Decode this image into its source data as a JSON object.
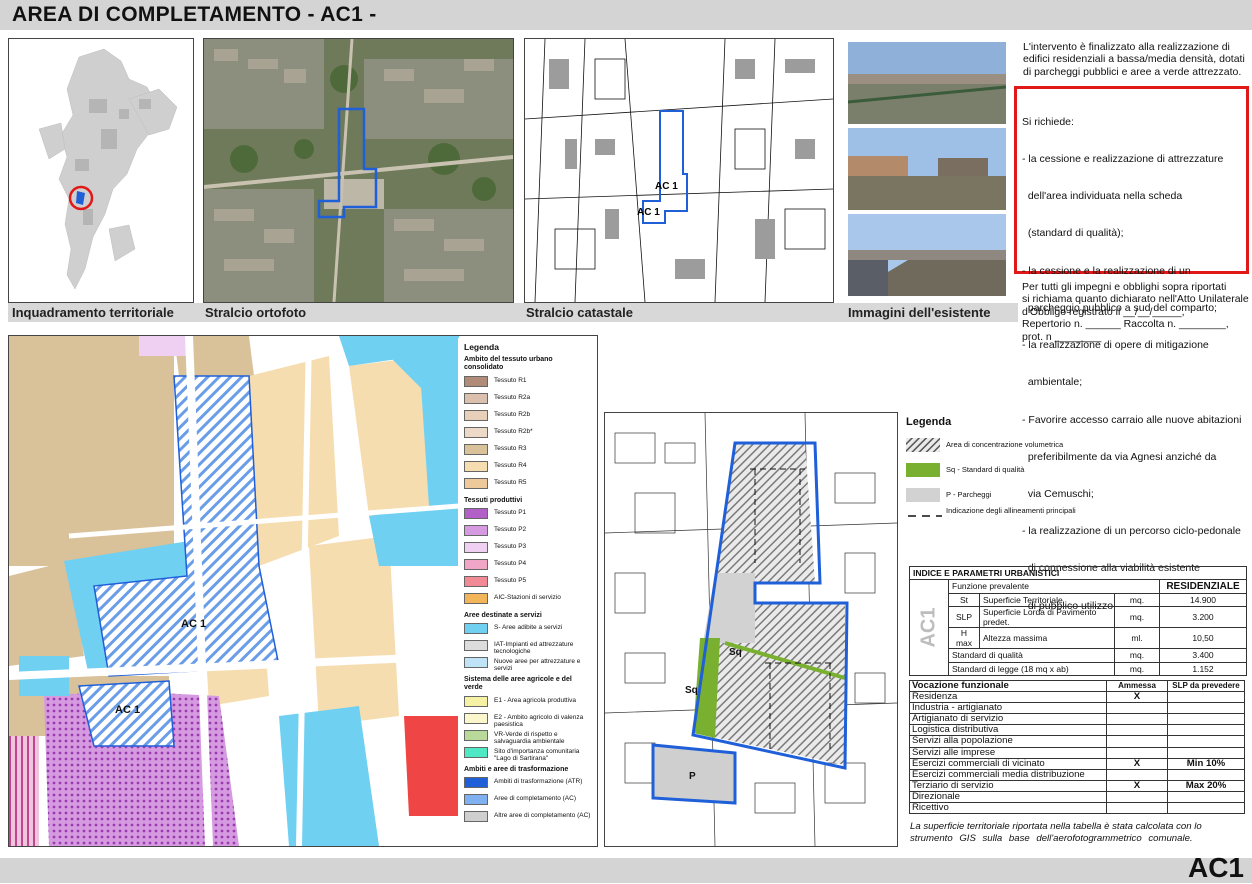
{
  "title": "AREA DI COMPLETAMENTO - AC1 -",
  "code": "AC1",
  "captions": {
    "territorial": "Inquadramento territoriale",
    "ortofoto": "Stralcio ortofoto",
    "catastale": "Stralcio catastale",
    "immagini": "Immagini dell'esistente"
  },
  "intro": [
    "L'intervento è finalizzato alla realizzazione di",
    "edifici residenziali a bassa/media densità, dotati",
    "di parcheggi pubblici e aree a verde attrezzato."
  ],
  "requirements": {
    "heading": "Si richiede:",
    "lines": [
      "- la cessione e realizzazione di attrezzature",
      "  dell'area individuata nella scheda",
      "  (standard di qualità);",
      "- la cessione e la realizzazione di un",
      "  parcheggio pubblico a sud del comparto;",
      "- la realizzazione di opere di mitigazione",
      "  ambientale;",
      "- Favorire accesso carraio alle nuove abitazioni",
      "  preferibilmente da via Agnesi anziché da",
      "  via Cemuschi;",
      "- la realizzazione di un percorso ciclo-pedonale",
      "  di connessione alla viabilità esistente",
      "  di pubblico utilizzo."
    ]
  },
  "obligations": [
    "Per tutti gli impegni e obblighi sopra riportati",
    "si richiama quanto dichiarato nell'Atto Unilaterale",
    "d'Obbligo registrato il __/__/_____,",
    "Repertorio n. ______ Raccolta n. ________,",
    "prot. n ________"
  ],
  "plan_map": {
    "labels": [
      "AC 1",
      "AC 1"
    ],
    "legend": {
      "title": "Legenda",
      "sections": [
        {
          "heading": "Ambito del tessuto urbano consolidato",
          "items": [
            {
              "label": "Tessuto R1",
              "color": "#b08c78"
            },
            {
              "label": "Tessuto R2a",
              "color": "#dcc0ae"
            },
            {
              "label": "Tessuto R2b",
              "color": "#e8cfb9"
            },
            {
              "label": "Tessuto R2b*",
              "color": "#ecd9c8"
            },
            {
              "label": "Tessuto R3",
              "color": "#d9c19a"
            },
            {
              "label": "Tessuto R4",
              "color": "#f6ddb0"
            },
            {
              "label": "Tessuto R5",
              "color": "#edc99c"
            }
          ]
        },
        {
          "heading": "Tessuti produttivi",
          "items": [
            {
              "label": "Tessuto P1",
              "color": "#b35fc8"
            },
            {
              "label": "Tessuto P2",
              "color": "#d59ae0"
            },
            {
              "label": "Tessuto P3",
              "color": "#efd0f2"
            },
            {
              "label": "Tessuto P4",
              "color": "#f0a6c6"
            },
            {
              "label": "Tessuto P5",
              "color": "#f28a96"
            },
            {
              "label": "AIC-Stazioni di servizio",
              "color": "#f2b55a"
            }
          ]
        },
        {
          "heading": "Aree destinate a servizi",
          "items": [
            {
              "label": "S- Aree adibite a servizi",
              "color": "#6fd0f2"
            },
            {
              "label": "IAT-Impianti ed attrezzature tecnologiche",
              "color": "#dcdcdc"
            },
            {
              "label": "Nuove aree per attrezzature e servizi",
              "color": "#bfe4f7"
            }
          ]
        },
        {
          "heading": "Sistema delle aree agricole e del verde",
          "items": [
            {
              "label": "E1 - Area agricola produttiva",
              "color": "#f5f2a6"
            },
            {
              "label": "E2 - Ambito agricolo di valenza paesistica",
              "color": "#fbf6cc"
            },
            {
              "label": "VR-Verde di rispetto e salvaguardia ambientale",
              "color": "#b9d99a"
            },
            {
              "label": "Sito d'importanza comunitaria \"Lago di Sartirana\"",
              "color": "#4ee8c5"
            }
          ]
        },
        {
          "heading": "Ambiti e aree di trasformazione",
          "items": [
            {
              "label": "Ambiti di trasformazione (ATR)",
              "color": "#1f5fd8"
            },
            {
              "label": "Aree di completamento (AC)",
              "color": "#7fb0f0"
            },
            {
              "label": "Altre aree di completamento (AC)",
              "color": "#cfcfcf"
            }
          ]
        }
      ]
    }
  },
  "scheme_map": {
    "labels": {
      "sq1": "Sq",
      "sq2": "Sq",
      "p": "P"
    },
    "legend": {
      "title": "Legenda",
      "items": [
        "Area di concentrazione volumetrica",
        "Sq - Standard di qualità",
        "P -  Parcheggi",
        "Indicazione degli allineamenti principali"
      ]
    }
  },
  "indices": {
    "title": "INDICE E PARAMETRI URBANISTICI",
    "side_label": "AC1",
    "rows": [
      {
        "sym": "",
        "desc": "Funzione prevalente",
        "unit": "",
        "value": "RESIDENZIALE"
      },
      {
        "sym": "St",
        "desc": "Superficie Territoriale",
        "unit": "mq.",
        "value": "14.900"
      },
      {
        "sym": "SLP",
        "desc": "Superficie Lorda di Pavimento predet.",
        "unit": "mq.",
        "value": "3.200"
      },
      {
        "sym": "H max",
        "desc": "Altezza massima",
        "unit": "ml.",
        "value": "10,50"
      },
      {
        "sym": "",
        "desc": "Standard di qualità",
        "unit": "mq.",
        "value": "3.400"
      },
      {
        "sym": "",
        "desc": "Standard di legge (18 mq x ab)",
        "unit": "mq.",
        "value": "1.152"
      }
    ]
  },
  "vocazione": {
    "headers": [
      "Vocazione funzionale",
      "Ammessa",
      "SLP da prevedere"
    ],
    "rows": [
      {
        "name": "Residenza",
        "ammessa": "X",
        "slp": ""
      },
      {
        "name": "Industria - artigianato",
        "ammessa": "",
        "slp": ""
      },
      {
        "name": "Artigianato di servizio",
        "ammessa": "",
        "slp": ""
      },
      {
        "name": "Logistica distributiva",
        "ammessa": "",
        "slp": ""
      },
      {
        "name": "Servizi alla popolazione",
        "ammessa": "",
        "slp": ""
      },
      {
        "name": "Servizi alle imprese",
        "ammessa": "",
        "slp": ""
      },
      {
        "name": "Esercizi commerciali di vicinato",
        "ammessa": "X",
        "slp": "Min 10%"
      },
      {
        "name": "Esercizi commerciali media distribuzione",
        "ammessa": "",
        "slp": ""
      },
      {
        "name": "Terziario di servizio",
        "ammessa": "X",
        "slp": "Max 20%"
      },
      {
        "name": "Direzionale",
        "ammessa": "",
        "slp": ""
      },
      {
        "name": "Ricettivo",
        "ammessa": "",
        "slp": ""
      }
    ]
  },
  "note": [
    "La superficie territoriale riportata nella tabella è stata calcolata con lo",
    "strumento GIS sulla base dell'aerofotogrammetrico comunale."
  ]
}
